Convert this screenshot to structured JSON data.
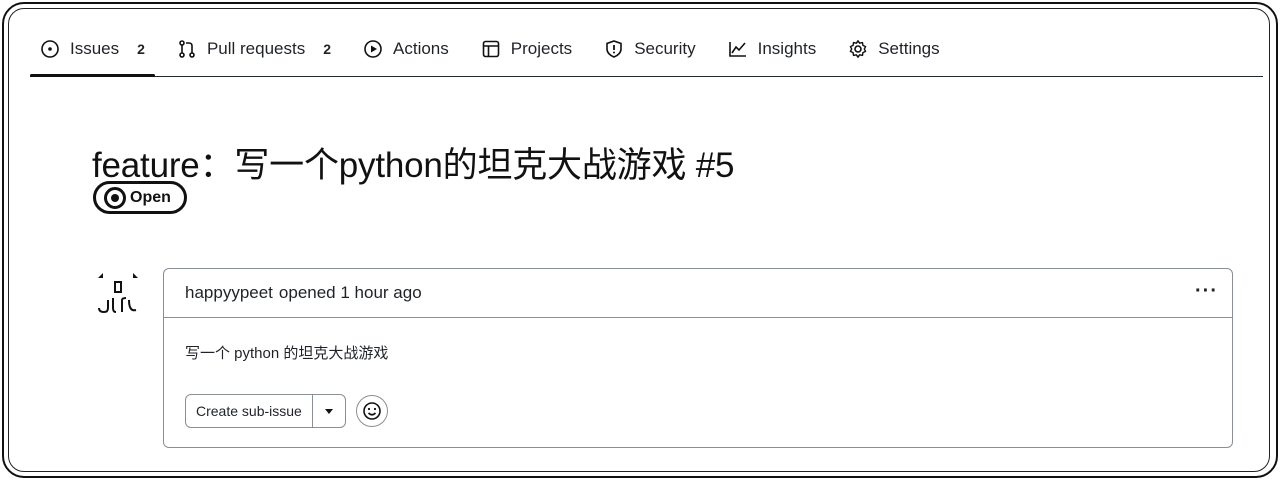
{
  "tabs": [
    {
      "label": "Issues",
      "count": "2",
      "icon": "issue-opened-icon"
    },
    {
      "label": "Pull requests",
      "count": "2",
      "icon": "git-pull-request-icon"
    },
    {
      "label": "Actions",
      "icon": "play-icon"
    },
    {
      "label": "Projects",
      "icon": "table-icon"
    },
    {
      "label": "Security",
      "icon": "shield-icon"
    },
    {
      "label": "Insights",
      "icon": "graph-icon"
    },
    {
      "label": "Settings",
      "icon": "gear-icon"
    }
  ],
  "issue": {
    "title": "feature：写一个python的坦克大战游戏 #5",
    "state": "Open"
  },
  "comment": {
    "author": "happyypeet",
    "meta": "opened 1 hour ago",
    "body": "写一个 python 的坦克大战游戏",
    "more_label": "···"
  },
  "actions": {
    "create_sub_issue": "Create sub-issue"
  },
  "colors": {
    "text": "#1f2328",
    "border": "#8a8f96",
    "accent": "#111111"
  }
}
